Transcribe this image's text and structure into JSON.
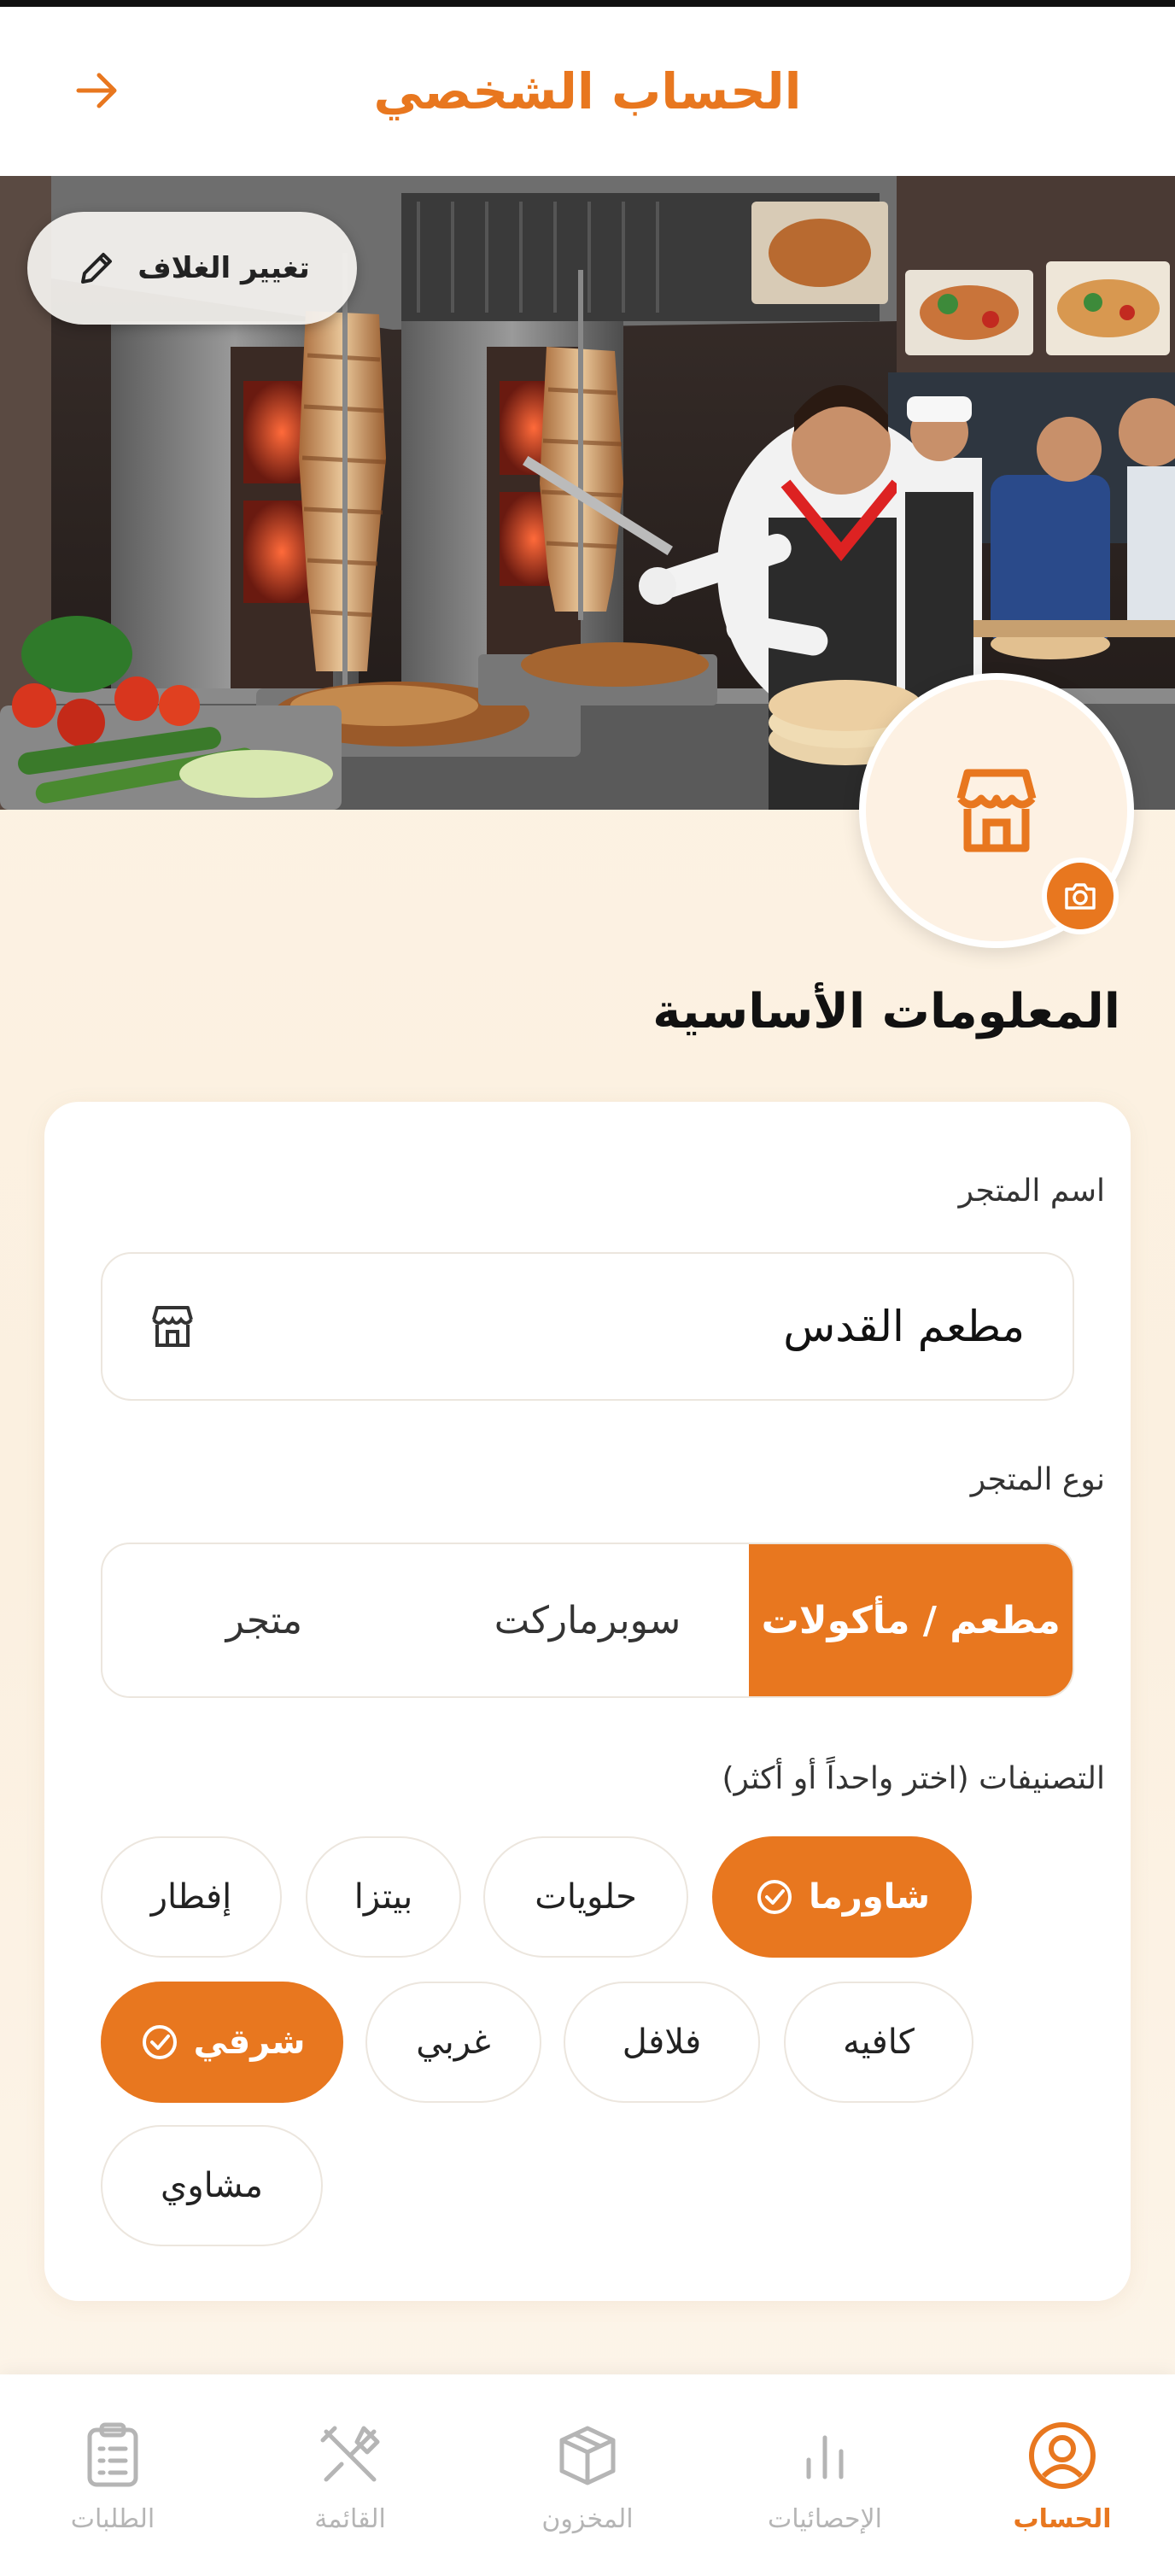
{
  "header": {
    "title": "الحساب الشخصي"
  },
  "cover": {
    "change_label": "تغيير الغلاف"
  },
  "section": {
    "title": "المعلومات الأساسية"
  },
  "store_name": {
    "label": "اسم المتجر",
    "value": "مطعم القدس"
  },
  "store_type": {
    "label": "نوع المتجر",
    "options": [
      "مطعم / مأكولات",
      "سوبرماركت",
      "متجر"
    ],
    "selected": "مطعم / مأكولات"
  },
  "categories": {
    "label": "التصنيفات (اختر واحداً أو أكثر)",
    "items": [
      {
        "label": "شاورما",
        "selected": true
      },
      {
        "label": "حلويات",
        "selected": false
      },
      {
        "label": "بيتزا",
        "selected": false
      },
      {
        "label": "إفطار",
        "selected": false
      },
      {
        "label": "كافيه",
        "selected": false
      },
      {
        "label": "فلافل",
        "selected": false
      },
      {
        "label": "غربي",
        "selected": false
      },
      {
        "label": "شرقي",
        "selected": true
      },
      {
        "label": "مشاوي",
        "selected": false
      }
    ]
  },
  "bottom_nav": {
    "items": [
      {
        "label": "الحساب",
        "icon": "user-circle-icon",
        "active": true
      },
      {
        "label": "الإحصائيات",
        "icon": "bar-chart-icon",
        "active": false
      },
      {
        "label": "المخزون",
        "icon": "box-icon",
        "active": false
      },
      {
        "label": "القائمة",
        "icon": "utensils-icon",
        "active": false
      },
      {
        "label": "الطلبات",
        "icon": "clipboard-icon",
        "active": false
      }
    ]
  },
  "colors": {
    "accent": "#e8771f",
    "text": "#111111",
    "muted": "#b5b5b5",
    "background": "#fbf0e0"
  }
}
